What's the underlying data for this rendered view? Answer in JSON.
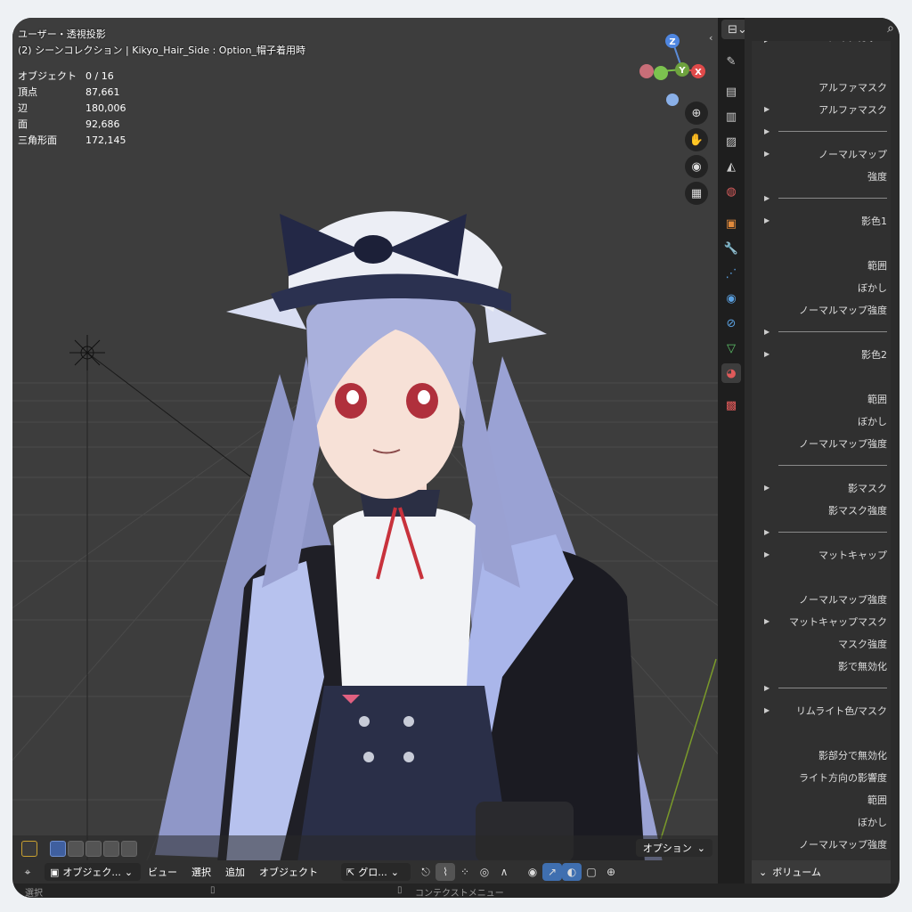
{
  "viewport": {
    "view_mode": "ユーザー・透視投影",
    "collection": "(2) シーンコレクション | Kikyo_Hair_Side : Option_帽子着用時",
    "stats": [
      {
        "label": "オブジェクト",
        "value": "0 / 16"
      },
      {
        "label": "頂点",
        "value": "87,661"
      },
      {
        "label": "辺",
        "value": "180,006"
      },
      {
        "label": "面",
        "value": "92,686"
      },
      {
        "label": "三角形面",
        "value": "172,145"
      }
    ],
    "gizmo": {
      "z": "Z",
      "y": "Y",
      "x": "X"
    },
    "options_label": "オプション",
    "nav_icons": [
      "zoom-icon",
      "hand-pan-icon",
      "camera-icon",
      "grid-perspective-icon"
    ]
  },
  "header": {
    "mode": "オブジェク...",
    "menu": [
      "ビュー",
      "選択",
      "追加",
      "オブジェクト"
    ],
    "transform": "グロ..."
  },
  "status": {
    "left": "選択",
    "right": "コンテクストメニュー"
  },
  "properties": {
    "top_partial": "メインカラー",
    "rows": [
      {
        "arrow": false,
        "label": "アルファマスク",
        "sep": false
      },
      {
        "arrow": true,
        "label": "アルファマスク",
        "sep": false
      },
      {
        "arrow": true,
        "label": "",
        "sep": true
      },
      {
        "arrow": true,
        "label": "ノーマルマップ",
        "sep": false
      },
      {
        "arrow": false,
        "label": "強度",
        "sep": false
      },
      {
        "arrow": true,
        "label": "",
        "sep": true
      },
      {
        "arrow": true,
        "label": "影色1",
        "sep": false
      },
      {
        "arrow": false,
        "label": "",
        "sep": false
      },
      {
        "arrow": false,
        "label": "範囲",
        "sep": false
      },
      {
        "arrow": false,
        "label": "ぼかし",
        "sep": false
      },
      {
        "arrow": false,
        "label": "ノーマルマップ強度",
        "sep": false
      },
      {
        "arrow": true,
        "label": "",
        "sep": true
      },
      {
        "arrow": true,
        "label": "影色2",
        "sep": false
      },
      {
        "arrow": false,
        "label": "",
        "sep": false
      },
      {
        "arrow": false,
        "label": "範囲",
        "sep": false
      },
      {
        "arrow": false,
        "label": "ぼかし",
        "sep": false
      },
      {
        "arrow": false,
        "label": "ノーマルマップ強度",
        "sep": false
      },
      {
        "arrow": false,
        "label": "",
        "sep": true
      },
      {
        "arrow": true,
        "label": "影マスク",
        "sep": false
      },
      {
        "arrow": false,
        "label": "影マスク強度",
        "sep": false
      },
      {
        "arrow": true,
        "label": "",
        "sep": true
      },
      {
        "arrow": true,
        "label": "マットキャップ",
        "sep": false
      },
      {
        "arrow": false,
        "label": "",
        "sep": false
      },
      {
        "arrow": false,
        "label": "ノーマルマップ強度",
        "sep": false
      },
      {
        "arrow": true,
        "label": "マットキャップマスク",
        "sep": false
      },
      {
        "arrow": false,
        "label": "マスク強度",
        "sep": false
      },
      {
        "arrow": false,
        "label": "影で無効化",
        "sep": false
      },
      {
        "arrow": true,
        "label": "",
        "sep": true
      },
      {
        "arrow": true,
        "label": "リムライト色/マスク",
        "sep": false
      },
      {
        "arrow": false,
        "label": "",
        "sep": false
      },
      {
        "arrow": false,
        "label": "影部分で無効化",
        "sep": false
      },
      {
        "arrow": false,
        "label": "ライト方向の影響度",
        "sep": false
      },
      {
        "arrow": false,
        "label": "範囲",
        "sep": false
      },
      {
        "arrow": false,
        "label": "ぼかし",
        "sep": false
      },
      {
        "arrow": false,
        "label": "ノーマルマップ強度",
        "sep": false
      }
    ],
    "volume_label": "ボリューム"
  },
  "tabs": [
    {
      "icon": "tool-icon",
      "color": "#cfcfcf"
    },
    {
      "icon": "render-icon",
      "color": "#cfcfcf"
    },
    {
      "icon": "output-icon",
      "color": "#cfcfcf"
    },
    {
      "icon": "view-layer-icon",
      "color": "#cfcfcf"
    },
    {
      "icon": "scene-icon",
      "color": "#cfcfcf"
    },
    {
      "icon": "world-icon",
      "color": "#d65c5c"
    },
    {
      "icon": "object-icon",
      "color": "#e08a3c"
    },
    {
      "icon": "modifier-icon",
      "color": "#5aa0e0"
    },
    {
      "icon": "particles-icon",
      "color": "#5aa0e0"
    },
    {
      "icon": "physics-icon",
      "color": "#5aa0e0"
    },
    {
      "icon": "constraints-icon",
      "color": "#5aa0e0"
    },
    {
      "icon": "data-icon",
      "color": "#5ec46a"
    },
    {
      "icon": "material-icon",
      "color": "#e05a5a"
    },
    {
      "icon": "texture-icon",
      "color": "#e05a5a"
    }
  ]
}
